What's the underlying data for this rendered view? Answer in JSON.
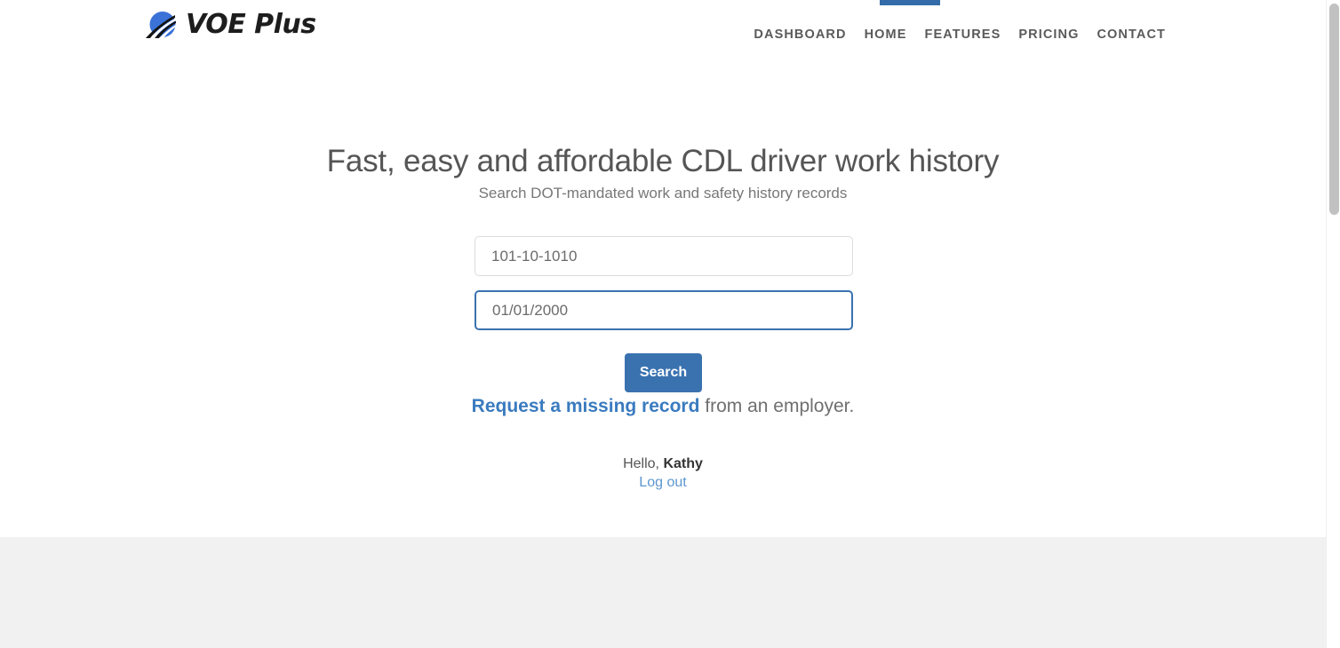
{
  "header": {
    "brand_name": "VOE Plus",
    "logo_icon": "road-circle-logo-icon",
    "nav": [
      {
        "label": "Dashboard",
        "name": "dashboard"
      },
      {
        "label": "Home",
        "name": "home"
      },
      {
        "label": "Features",
        "name": "features"
      },
      {
        "label": "Pricing",
        "name": "pricing"
      },
      {
        "label": "Contact",
        "name": "contact"
      }
    ]
  },
  "hero": {
    "title": "Fast, easy and affordable CDL driver work history",
    "subtitle": "Search DOT-mandated work and safety history records"
  },
  "form": {
    "ssn": {
      "value": "101-10-1010",
      "placeholder": "101-10-1010"
    },
    "dob": {
      "value": "01/01/2000",
      "placeholder": "01/01/2000"
    },
    "search_label": "Search"
  },
  "request": {
    "link_text": "Request a missing record",
    "suffix_text": " from an employer."
  },
  "account": {
    "greeting_prefix": "Hello, ",
    "user_name": "Kathy",
    "logout_label": "Log out"
  },
  "colors": {
    "accent_blue": "#3a72b0",
    "tab_blue": "#336ca8",
    "link_blue": "#3a7bbf",
    "logout_blue": "#5b96cf",
    "footer_gray": "#f1f1f1",
    "scrollbar_thumb": "#c1c1c1"
  }
}
